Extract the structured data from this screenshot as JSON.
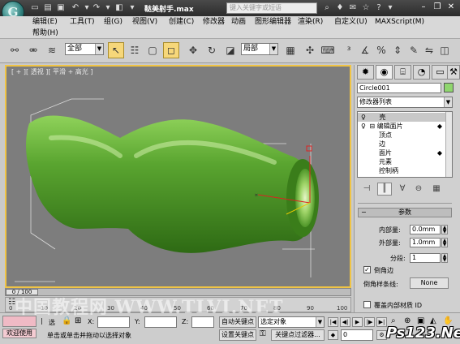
{
  "title_bar": {
    "document_title": "鞑美射手.max",
    "search_placeholder": "键入关键字或短语"
  },
  "menu": {
    "row1": [
      "编辑(E)",
      "工具(T)",
      "组(G)",
      "视图(V)",
      "创建(C)",
      "修改器",
      "动画",
      "图形编辑器",
      "渲染(R)",
      "自定义(U)",
      "MAXScript(M)"
    ],
    "row2": [
      "帮助(H)"
    ]
  },
  "toolbar": {
    "filter_select": "全部",
    "ref_coord_select": "局部"
  },
  "viewport": {
    "label": "[ + ][ 透视 ][ 平滑 + 高光 ]"
  },
  "command_panel": {
    "object_name": "Circle001",
    "object_color": "#8fd66e",
    "modifier_list": "修改器列表",
    "stack": [
      "壳",
      "编辑面片",
      "顶点",
      "边",
      "面片",
      "元素",
      "控制柄"
    ],
    "rollout_title": "参数",
    "params": {
      "inner_label": "内部量:",
      "inner_value": "0.0mm",
      "outer_label": "外部量:",
      "outer_value": "1.0mm",
      "segments_label": "分段:",
      "segments_value": "1",
      "bevel_edges_label": "倒角边",
      "bevel_spline_label": "倒角样条线:",
      "bevel_spline_button": "None",
      "override_inner_label": "覆盖内部材质 ID"
    }
  },
  "time_slider": {
    "position": "0 / 100",
    "ticks": [
      "0",
      "10",
      "20",
      "30",
      "40",
      "50",
      "60",
      "70",
      "80",
      "90",
      "100"
    ]
  },
  "status_bar": {
    "welcome": "欢迎使用",
    "selection_label": "选",
    "x_label": "X:",
    "y_label": "Y:",
    "z_label": "Z:",
    "auto_key": "自动关键点",
    "selected_objects": "选定对象",
    "set_key": "设置关键点",
    "key_filters": "关键点过滤器...",
    "frame_value": "0",
    "prompt": "单击或单击并拖动以选择对象"
  },
  "watermarks": {
    "site": "中国教程网 WWW.TLVI.NET",
    "ps": "Ps123.Net"
  },
  "colors": {
    "accent_yellow": "#f0c445",
    "vase_green": "#4f9b2a",
    "viewport_bg": "#7d7d7d"
  }
}
